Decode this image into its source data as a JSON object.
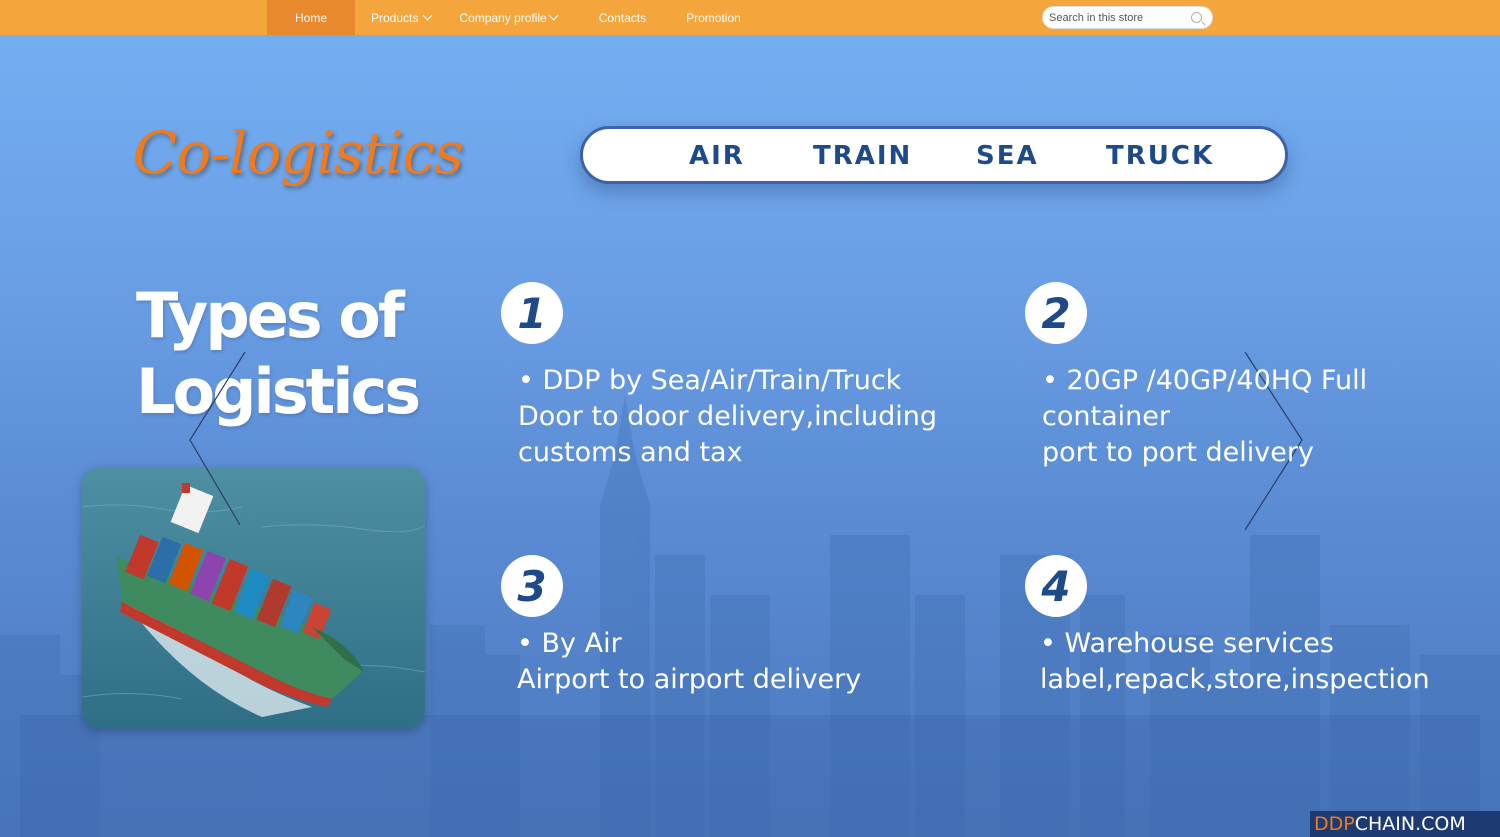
{
  "nav": {
    "items": [
      {
        "label": "Home",
        "active": true
      },
      {
        "label": "Products",
        "dropdown": true
      },
      {
        "label": "Company profile",
        "dropdown": true
      },
      {
        "label": "Contacts"
      },
      {
        "label": "Promotion"
      }
    ],
    "search_placeholder": "Search in this store"
  },
  "hero": {
    "brand": "Co-logistics",
    "modes": [
      "AIR",
      "TRAIN",
      "SEA",
      "TRUCK"
    ],
    "title_line1": "Types of",
    "title_line2": "Logistics",
    "items": [
      {
        "number": "1",
        "lines": [
          "• DDP by Sea/Air/Train/Truck",
          "Door to door delivery,including",
          "customs and tax"
        ]
      },
      {
        "number": "2",
        "lines": [
          "• 20GP /40GP/40HQ Full",
          "container",
          "port to port delivery"
        ]
      },
      {
        "number": "3",
        "lines": [
          "• By Air",
          "Airport to airport delivery"
        ]
      },
      {
        "number": "4",
        "lines": [
          "• Warehouse services",
          "label,repack,store,inspection"
        ]
      }
    ]
  },
  "watermark": {
    "accent": "DDP",
    "rest": "CHAIN.COM"
  },
  "colors": {
    "nav_bg": "#f4a53b",
    "nav_active": "#e8892e",
    "brand": "#f07a1e",
    "mode_text": "#1f4a8a",
    "hero_bg": "#6a9fe6"
  }
}
